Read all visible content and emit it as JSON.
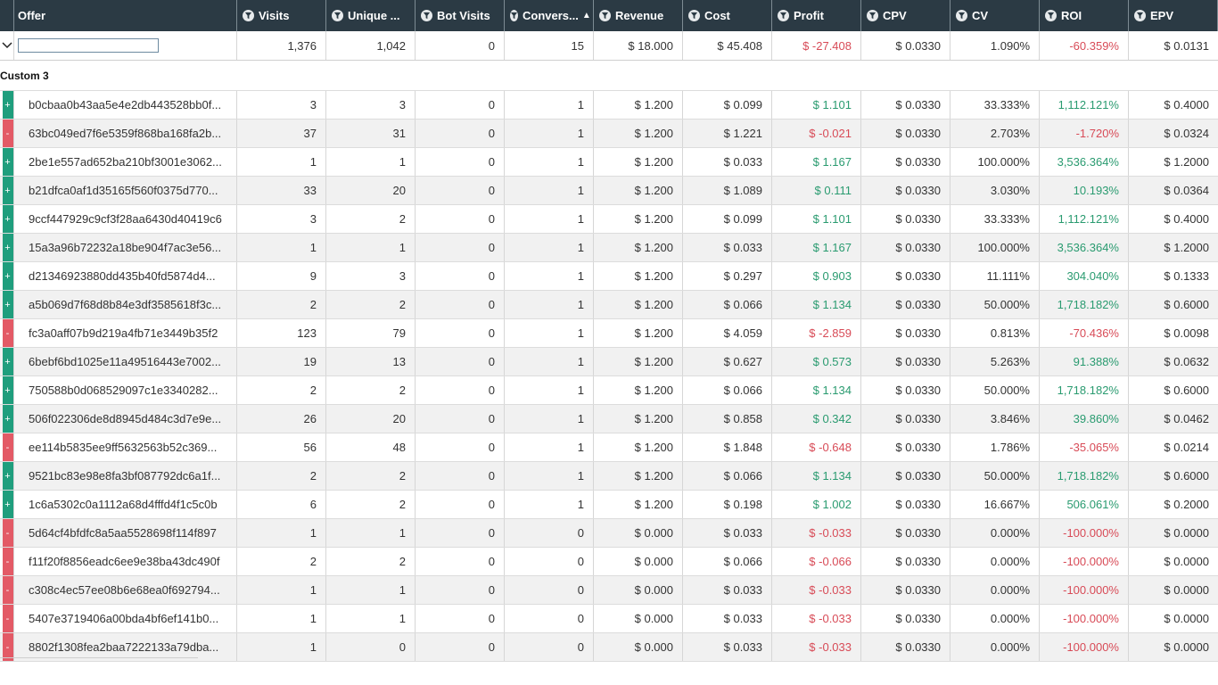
{
  "columns": [
    {
      "label": "Offer",
      "filter": false
    },
    {
      "label": "Visits",
      "filter": true
    },
    {
      "label": "Unique ...",
      "filter": true
    },
    {
      "label": "Bot Visits",
      "filter": true
    },
    {
      "label": "Convers...",
      "filter": true,
      "sort": "asc"
    },
    {
      "label": "Revenue",
      "filter": true
    },
    {
      "label": "Cost",
      "filter": true
    },
    {
      "label": "Profit",
      "filter": true
    },
    {
      "label": "CPV",
      "filter": true
    },
    {
      "label": "CV",
      "filter": true
    },
    {
      "label": "ROI",
      "filter": true
    },
    {
      "label": "EPV",
      "filter": true
    }
  ],
  "totals": {
    "search_value": "",
    "values": [
      "1,376",
      "1,042",
      "0",
      "15",
      "$ 18.000",
      "$ 45.408",
      "$ -27.408",
      "$ 0.0330",
      "1.090%",
      "-60.359%",
      "$ 0.0131"
    ]
  },
  "group_label": "Custom 3",
  "colors": {
    "header_bg": "#2b3a44",
    "positive": "#1f9e7d",
    "negative": "#e35a66",
    "positive_text": "#2a9b70",
    "negative_text": "#d84b57"
  },
  "rows": [
    {
      "sign": "+",
      "offer": "b0cbaa0b43aa5e4e2db443528bb0f...",
      "visits": "3",
      "unique": "3",
      "bot": "0",
      "conv": "1",
      "revenue": "$ 1.200",
      "cost": "$ 0.099",
      "profit": "$ 1.101",
      "cpv": "$ 0.0330",
      "cv": "33.333%",
      "roi": "1,112.121%",
      "epv": "$ 0.4000"
    },
    {
      "sign": "-",
      "offer": "63bc049ed7f6e5359f868ba168fa2b...",
      "visits": "37",
      "unique": "31",
      "bot": "0",
      "conv": "1",
      "revenue": "$ 1.200",
      "cost": "$ 1.221",
      "profit": "$ -0.021",
      "cpv": "$ 0.0330",
      "cv": "2.703%",
      "roi": "-1.720%",
      "epv": "$ 0.0324"
    },
    {
      "sign": "+",
      "offer": "2be1e557ad652ba210bf3001e3062...",
      "visits": "1",
      "unique": "1",
      "bot": "0",
      "conv": "1",
      "revenue": "$ 1.200",
      "cost": "$ 0.033",
      "profit": "$ 1.167",
      "cpv": "$ 0.0330",
      "cv": "100.000%",
      "roi": "3,536.364%",
      "epv": "$ 1.2000"
    },
    {
      "sign": "+",
      "offer": "b21dfca0af1d35165f560f0375d770...",
      "visits": "33",
      "unique": "20",
      "bot": "0",
      "conv": "1",
      "revenue": "$ 1.200",
      "cost": "$ 1.089",
      "profit": "$ 0.111",
      "cpv": "$ 0.0330",
      "cv": "3.030%",
      "roi": "10.193%",
      "epv": "$ 0.0364"
    },
    {
      "sign": "+",
      "offer": "9ccf447929c9cf3f28aa6430d40419c6",
      "visits": "3",
      "unique": "2",
      "bot": "0",
      "conv": "1",
      "revenue": "$ 1.200",
      "cost": "$ 0.099",
      "profit": "$ 1.101",
      "cpv": "$ 0.0330",
      "cv": "33.333%",
      "roi": "1,112.121%",
      "epv": "$ 0.4000"
    },
    {
      "sign": "+",
      "offer": "15a3a96b72232a18be904f7ac3e56...",
      "visits": "1",
      "unique": "1",
      "bot": "0",
      "conv": "1",
      "revenue": "$ 1.200",
      "cost": "$ 0.033",
      "profit": "$ 1.167",
      "cpv": "$ 0.0330",
      "cv": "100.000%",
      "roi": "3,536.364%",
      "epv": "$ 1.2000"
    },
    {
      "sign": "+",
      "offer": "d21346923880dd435b40fd5874d4...",
      "visits": "9",
      "unique": "3",
      "bot": "0",
      "conv": "1",
      "revenue": "$ 1.200",
      "cost": "$ 0.297",
      "profit": "$ 0.903",
      "cpv": "$ 0.0330",
      "cv": "11.111%",
      "roi": "304.040%",
      "epv": "$ 0.1333"
    },
    {
      "sign": "+",
      "offer": "a5b069d7f68d8b84e3df3585618f3c...",
      "visits": "2",
      "unique": "2",
      "bot": "0",
      "conv": "1",
      "revenue": "$ 1.200",
      "cost": "$ 0.066",
      "profit": "$ 1.134",
      "cpv": "$ 0.0330",
      "cv": "50.000%",
      "roi": "1,718.182%",
      "epv": "$ 0.6000"
    },
    {
      "sign": "-",
      "offer": "fc3a0aff07b9d219a4fb71e3449b35f2",
      "visits": "123",
      "unique": "79",
      "bot": "0",
      "conv": "1",
      "revenue": "$ 1.200",
      "cost": "$ 4.059",
      "profit": "$ -2.859",
      "cpv": "$ 0.0330",
      "cv": "0.813%",
      "roi": "-70.436%",
      "epv": "$ 0.0098"
    },
    {
      "sign": "+",
      "offer": "6bebf6bd1025e11a49516443e7002...",
      "visits": "19",
      "unique": "13",
      "bot": "0",
      "conv": "1",
      "revenue": "$ 1.200",
      "cost": "$ 0.627",
      "profit": "$ 0.573",
      "cpv": "$ 0.0330",
      "cv": "5.263%",
      "roi": "91.388%",
      "epv": "$ 0.0632"
    },
    {
      "sign": "+",
      "offer": "750588b0d068529097c1e3340282...",
      "visits": "2",
      "unique": "2",
      "bot": "0",
      "conv": "1",
      "revenue": "$ 1.200",
      "cost": "$ 0.066",
      "profit": "$ 1.134",
      "cpv": "$ 0.0330",
      "cv": "50.000%",
      "roi": "1,718.182%",
      "epv": "$ 0.6000"
    },
    {
      "sign": "+",
      "offer": "506f022306de8d8945d484c3d7e9e...",
      "visits": "26",
      "unique": "20",
      "bot": "0",
      "conv": "1",
      "revenue": "$ 1.200",
      "cost": "$ 0.858",
      "profit": "$ 0.342",
      "cpv": "$ 0.0330",
      "cv": "3.846%",
      "roi": "39.860%",
      "epv": "$ 0.0462"
    },
    {
      "sign": "-",
      "offer": "ee114b5835ee9ff5632563b52c369...",
      "visits": "56",
      "unique": "48",
      "bot": "0",
      "conv": "1",
      "revenue": "$ 1.200",
      "cost": "$ 1.848",
      "profit": "$ -0.648",
      "cpv": "$ 0.0330",
      "cv": "1.786%",
      "roi": "-35.065%",
      "epv": "$ 0.0214"
    },
    {
      "sign": "+",
      "offer": "9521bc83e98e8fa3bf087792dc6a1f...",
      "visits": "2",
      "unique": "2",
      "bot": "0",
      "conv": "1",
      "revenue": "$ 1.200",
      "cost": "$ 0.066",
      "profit": "$ 1.134",
      "cpv": "$ 0.0330",
      "cv": "50.000%",
      "roi": "1,718.182%",
      "epv": "$ 0.6000"
    },
    {
      "sign": "+",
      "offer": "1c6a5302c0a1112a68d4fffd4f1c5c0b",
      "visits": "6",
      "unique": "2",
      "bot": "0",
      "conv": "1",
      "revenue": "$ 1.200",
      "cost": "$ 0.198",
      "profit": "$ 1.002",
      "cpv": "$ 0.0330",
      "cv": "16.667%",
      "roi": "506.061%",
      "epv": "$ 0.2000"
    },
    {
      "sign": "-",
      "offer": "5d64cf4bfdfc8a5aa5528698f114f897",
      "visits": "1",
      "unique": "1",
      "bot": "0",
      "conv": "0",
      "revenue": "$ 0.000",
      "cost": "$ 0.033",
      "profit": "$ -0.033",
      "cpv": "$ 0.0330",
      "cv": "0.000%",
      "roi": "-100.000%",
      "epv": "$ 0.0000"
    },
    {
      "sign": "-",
      "offer": "f11f20f8856eadc6ee9e38ba43dc490f",
      "visits": "2",
      "unique": "2",
      "bot": "0",
      "conv": "0",
      "revenue": "$ 0.000",
      "cost": "$ 0.066",
      "profit": "$ -0.066",
      "cpv": "$ 0.0330",
      "cv": "0.000%",
      "roi": "-100.000%",
      "epv": "$ 0.0000"
    },
    {
      "sign": "-",
      "offer": "c308c4ec57ee08b6e68ea0f692794...",
      "visits": "1",
      "unique": "1",
      "bot": "0",
      "conv": "0",
      "revenue": "$ 0.000",
      "cost": "$ 0.033",
      "profit": "$ -0.033",
      "cpv": "$ 0.0330",
      "cv": "0.000%",
      "roi": "-100.000%",
      "epv": "$ 0.0000"
    },
    {
      "sign": "-",
      "offer": "5407e3719406a00bda4bf6ef141b0...",
      "visits": "1",
      "unique": "1",
      "bot": "0",
      "conv": "0",
      "revenue": "$ 0.000",
      "cost": "$ 0.033",
      "profit": "$ -0.033",
      "cpv": "$ 0.0330",
      "cv": "0.000%",
      "roi": "-100.000%",
      "epv": "$ 0.0000"
    },
    {
      "sign": "-",
      "offer": "8802f1308fea2baa7222133a79dba...",
      "visits": "1",
      "unique": "0",
      "bot": "0",
      "conv": "0",
      "revenue": "$ 0.000",
      "cost": "$ 0.033",
      "profit": "$ -0.033",
      "cpv": "$ 0.0330",
      "cv": "0.000%",
      "roi": "-100.000%",
      "epv": "$ 0.0000"
    }
  ]
}
